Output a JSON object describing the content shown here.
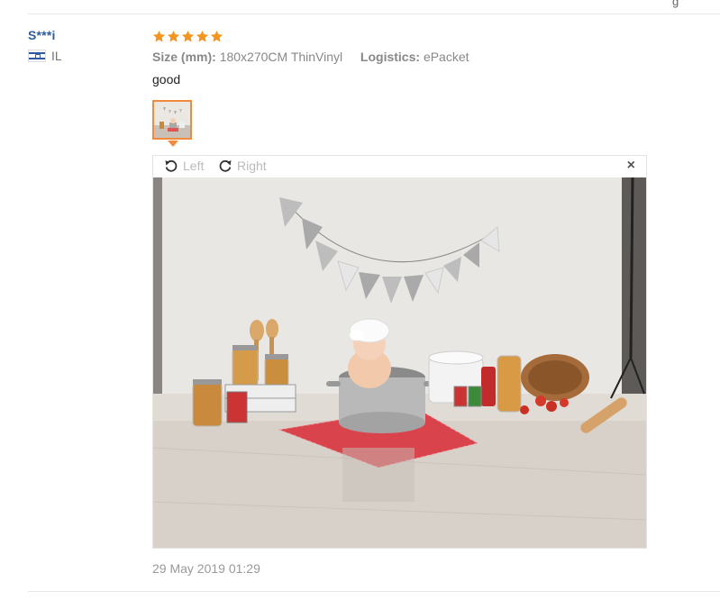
{
  "buyer": {
    "name": "S***i",
    "country_code": "IL"
  },
  "review": {
    "rating": 5,
    "rating_max": 5,
    "star_color": "#f7941d",
    "attributes": [
      {
        "label": "Size (mm):",
        "value": "180x270CM ThinVinyl"
      },
      {
        "label": "Logistics:",
        "value": "ePacket"
      }
    ],
    "text": "good",
    "date": "29 May 2019 01:29"
  },
  "viewer": {
    "rotate_left_label": "Left",
    "rotate_right_label": "Right",
    "close_symbol": "×",
    "accent_color": "#f28a3b"
  }
}
